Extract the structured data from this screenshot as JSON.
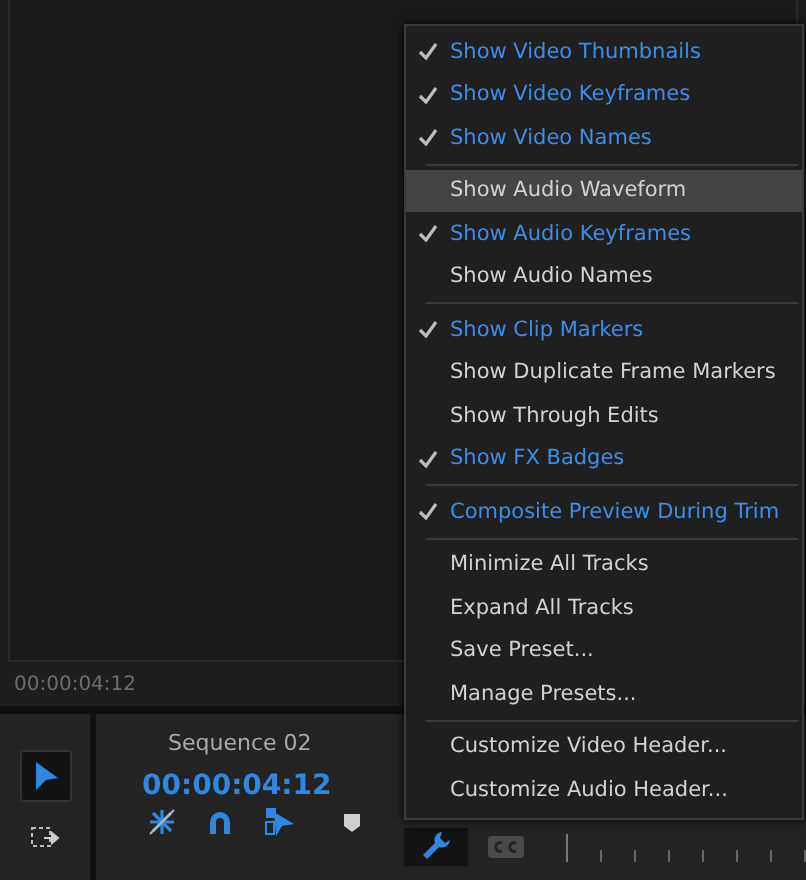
{
  "program_monitor": {
    "timecode": "00:00:04:12"
  },
  "tools": [
    {
      "kind": "selection",
      "selected": true
    },
    {
      "kind": "track-select",
      "selected": false
    }
  ],
  "timeline": {
    "title": "Sequence 02",
    "timecode": "00:00:04:12"
  },
  "menu": [
    {
      "kind": "item",
      "label": "Show Video Thumbnails",
      "checked": true,
      "selected": false
    },
    {
      "kind": "item",
      "label": "Show Video Keyframes",
      "checked": true,
      "selected": false
    },
    {
      "kind": "item",
      "label": "Show Video Names",
      "checked": true,
      "selected": false
    },
    {
      "kind": "separator"
    },
    {
      "kind": "item",
      "label": "Show Audio Waveform",
      "checked": false,
      "selected": true
    },
    {
      "kind": "item",
      "label": "Show Audio Keyframes",
      "checked": true,
      "selected": false
    },
    {
      "kind": "item",
      "label": "Show Audio Names",
      "checked": false,
      "selected": false
    },
    {
      "kind": "separator"
    },
    {
      "kind": "item",
      "label": "Show Clip Markers",
      "checked": true,
      "selected": false
    },
    {
      "kind": "item",
      "label": "Show Duplicate Frame Markers",
      "checked": false,
      "selected": false
    },
    {
      "kind": "item",
      "label": "Show Through Edits",
      "checked": false,
      "selected": false
    },
    {
      "kind": "item",
      "label": "Show FX Badges",
      "checked": true,
      "selected": false
    },
    {
      "kind": "separator"
    },
    {
      "kind": "item",
      "label": "Composite Preview During Trim",
      "checked": true,
      "selected": false
    },
    {
      "kind": "separator"
    },
    {
      "kind": "item",
      "label": "Minimize All Tracks",
      "checked": false,
      "selected": false
    },
    {
      "kind": "item",
      "label": "Expand All Tracks",
      "checked": false,
      "selected": false
    },
    {
      "kind": "item",
      "label": "Save Preset...",
      "checked": false,
      "selected": false
    },
    {
      "kind": "item",
      "label": "Manage Presets...",
      "checked": false,
      "selected": false
    },
    {
      "kind": "separator"
    },
    {
      "kind": "item",
      "label": "Customize Video Header...",
      "checked": false,
      "selected": false
    },
    {
      "kind": "item",
      "label": "Customize Audio Header...",
      "checked": false,
      "selected": false
    }
  ],
  "settings_button": {
    "selected": true
  }
}
